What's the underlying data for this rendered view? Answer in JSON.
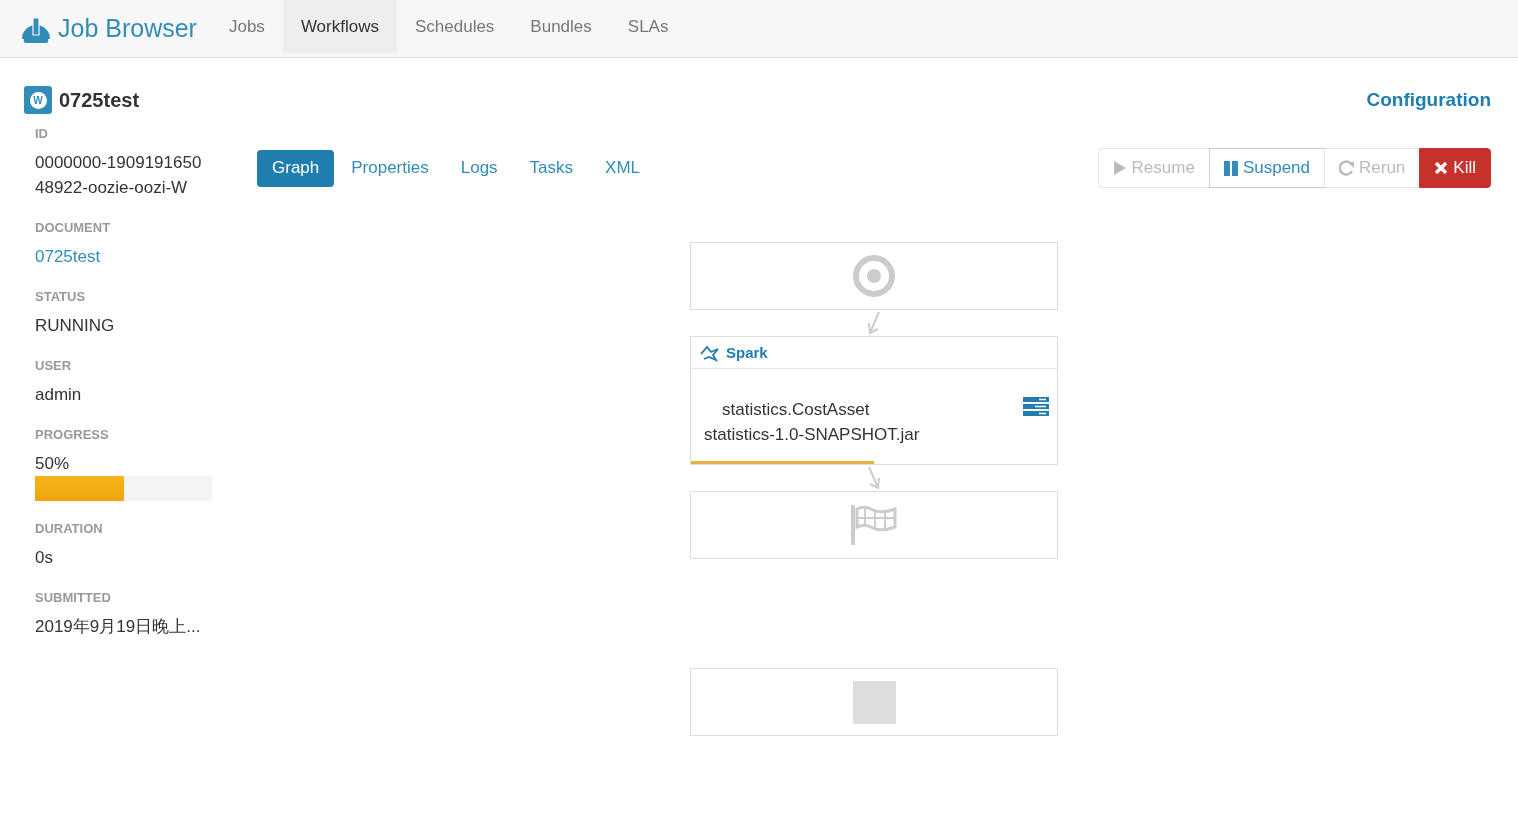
{
  "app": {
    "title": "Job Browser"
  },
  "nav_tabs": [
    {
      "label": "Jobs",
      "selected": false
    },
    {
      "label": "Workflows",
      "selected": true
    },
    {
      "label": "Schedules",
      "selected": false
    },
    {
      "label": "Bundles",
      "selected": false
    },
    {
      "label": "SLAs",
      "selected": false
    }
  ],
  "job": {
    "badge": "W",
    "title": "0725test",
    "configuration_link": "Configuration"
  },
  "properties": [
    {
      "label": "ID",
      "kind": "text",
      "value": "0000000-190919165048922-oozie-oozi-W"
    },
    {
      "label": "DOCUMENT",
      "kind": "link",
      "value": "0725test"
    },
    {
      "label": "STATUS",
      "kind": "text",
      "value": "RUNNING"
    },
    {
      "label": "USER",
      "kind": "text",
      "value": "admin"
    },
    {
      "label": "PROGRESS",
      "kind": "progress",
      "value": "50%",
      "level": 0.5
    },
    {
      "label": "DURATION",
      "kind": "text",
      "value": "0s"
    },
    {
      "label": "SUBMITTED",
      "kind": "text",
      "value": "2019年9月19日晚上..."
    }
  ],
  "view_tabs": [
    {
      "label": "Graph",
      "selected": true
    },
    {
      "label": "Properties",
      "selected": false
    },
    {
      "label": "Logs",
      "selected": false
    },
    {
      "label": "Tasks",
      "selected": false
    },
    {
      "label": "XML",
      "selected": false
    }
  ],
  "actions": [
    {
      "label": "Resume",
      "kind": "resume",
      "disabled": true
    },
    {
      "label": "Suspend",
      "kind": "suspend",
      "disabled": false
    },
    {
      "label": "Rerun",
      "kind": "rerun",
      "disabled": true
    },
    {
      "label": "Kill",
      "kind": "kill",
      "disabled": false
    }
  ],
  "graph": {
    "nodes": [
      {
        "kind": "start"
      },
      {
        "kind": "action",
        "title": "Spark",
        "lines": [
          "statistics.CostAsset",
          "statistics-1.0-SNAPSHOT.jar"
        ],
        "level": 0.5
      },
      {
        "kind": "end"
      },
      {
        "kind": "kill"
      }
    ]
  }
}
